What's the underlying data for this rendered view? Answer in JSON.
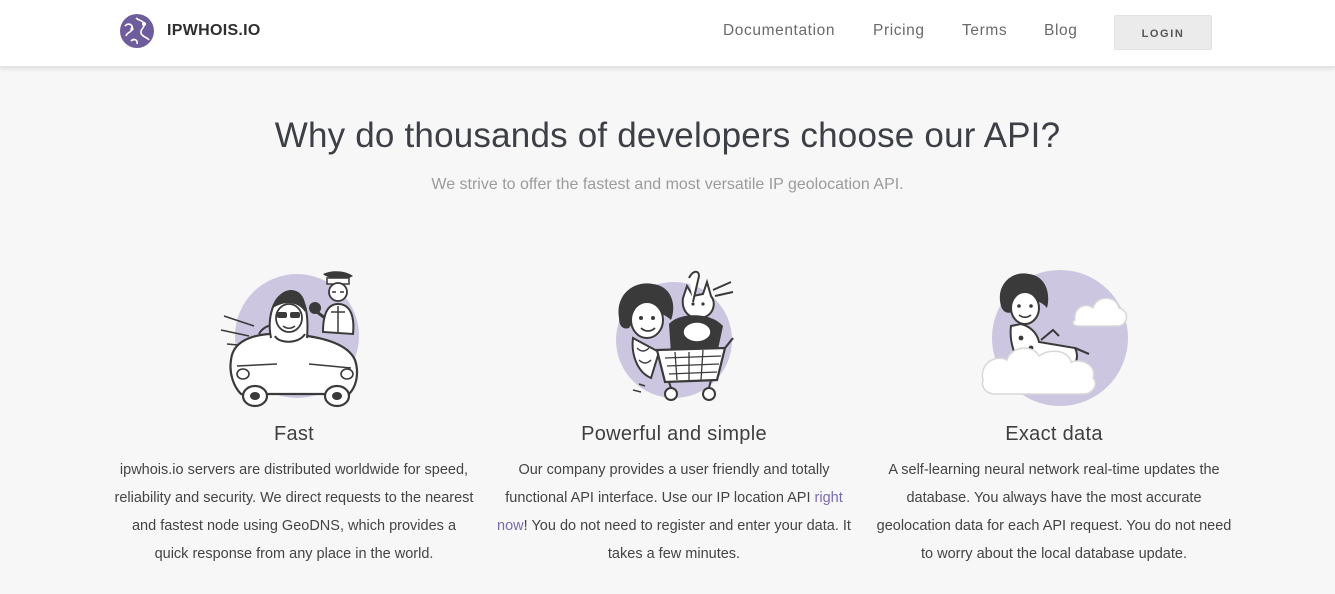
{
  "header": {
    "brand": "IPWHOIS.IO",
    "nav": [
      {
        "label": "Documentation"
      },
      {
        "label": "Pricing"
      },
      {
        "label": "Terms"
      },
      {
        "label": "Blog"
      }
    ],
    "login_label": "LOGIN"
  },
  "hero": {
    "title": "Why do thousands of developers choose our API?",
    "subtitle": "We strive to offer the fastest and most versatile IP geolocation API."
  },
  "features": [
    {
      "icon": "convertible-car-illustration",
      "title": "Fast",
      "text": "ipwhois.io servers are distributed worldwide for speed, reliability and security. We direct requests to the nearest and fastest node using GeoDNS, which provides a quick response from any place in the world."
    },
    {
      "icon": "shopping-cart-illustration",
      "title": "Powerful and simple",
      "text_before": "Our company provides a user friendly and totally functional API interface. Use our IP location API ",
      "link": "right now",
      "text_after": "! You do not need to register and enter your data. It takes a few minutes."
    },
    {
      "icon": "cloud-illustration",
      "title": "Exact data",
      "text": "A self-learning neural network real-time updates the database. You always have the most accurate geolocation data for each API request. You do not need to worry about the local database update."
    }
  ],
  "colors": {
    "accent": "#6f5c9d",
    "illustration_circle": "#cdc6e0",
    "link": "#7a6bab",
    "page_background": "#f7f7f7"
  }
}
